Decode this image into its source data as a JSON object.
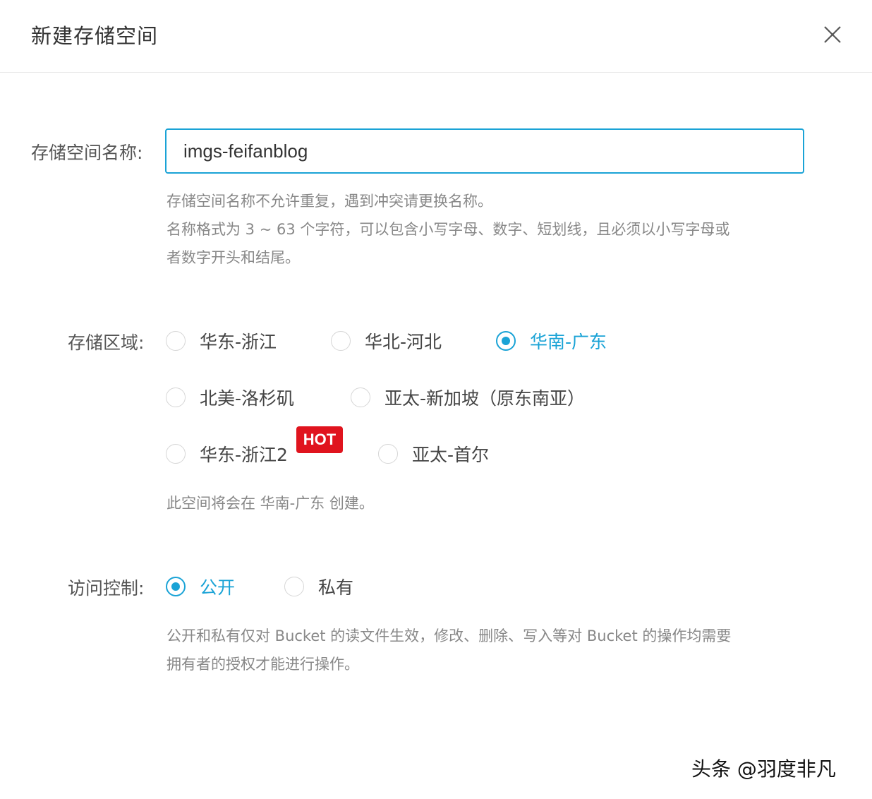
{
  "dialog": {
    "title": "新建存储空间",
    "close_icon": "close-icon"
  },
  "bucket_name": {
    "label": "存储空间名称:",
    "value": "imgs-feifanblog",
    "help_lines": [
      "存储空间名称不允许重复，遇到冲突请更换名称。",
      "名称格式为 3 ~ 63 个字符，可以包含小写字母、数字、短划线，且必须以小写字母或",
      "者数字开头和结尾。"
    ]
  },
  "region": {
    "label": "存储区域:",
    "selected": "华南-广东",
    "options": [
      {
        "label": "华东-浙江",
        "checked": false
      },
      {
        "label": "华北-河北",
        "checked": false
      },
      {
        "label": "华南-广东",
        "checked": true
      },
      {
        "label": "北美-洛杉矶",
        "checked": false
      },
      {
        "label": "亚太-新加坡（原东南亚）",
        "checked": false
      },
      {
        "label": "华东-浙江2",
        "checked": false,
        "badge": "HOT"
      },
      {
        "label": "亚太-首尔",
        "checked": false
      }
    ],
    "summary": "此空间将会在 华南-广东 创建。"
  },
  "access": {
    "label": "访问控制:",
    "options": [
      {
        "label": "公开",
        "checked": true
      },
      {
        "label": "私有",
        "checked": false
      }
    ],
    "help_lines": [
      "公开和私有仅对 Bucket 的读文件生效，修改、删除、写入等对 Bucket 的操作均需要",
      "拥有者的授权才能进行操作。"
    ]
  },
  "watermark": "头条 @羽度非凡",
  "colors": {
    "accent": "#1aa3d6",
    "hot_badge": "#e0141e",
    "help_text": "#888888"
  }
}
